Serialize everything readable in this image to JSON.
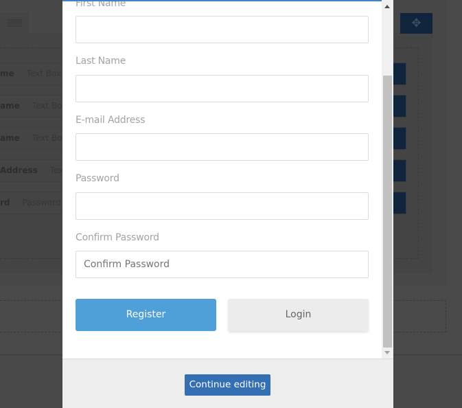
{
  "background": {
    "rows": [
      {
        "label": "me",
        "type": "Text Box"
      },
      {
        "label": "ame",
        "type": "Text Box"
      },
      {
        "label": "ame",
        "type": "Text Box"
      },
      {
        "label": "Address",
        "type": "Text"
      },
      {
        "label": "rd",
        "type": "Password"
      }
    ],
    "move_icon": "✥"
  },
  "form": {
    "fields": [
      {
        "label": "First Name",
        "value": "",
        "placeholder": ""
      },
      {
        "label": "Last Name",
        "value": "",
        "placeholder": ""
      },
      {
        "label": "E-mail Address",
        "value": "",
        "placeholder": ""
      },
      {
        "label": "Password",
        "value": "",
        "placeholder": ""
      },
      {
        "label": "Confirm Password",
        "value": "",
        "placeholder": "Confirm Password"
      }
    ],
    "register_label": "Register",
    "login_label": "Login"
  },
  "footer": {
    "continue_label": "Continue editing"
  },
  "colors": {
    "accent": "#4f9fd9",
    "primary": "#336fb2",
    "modal_top_border": "#3d85c6"
  }
}
